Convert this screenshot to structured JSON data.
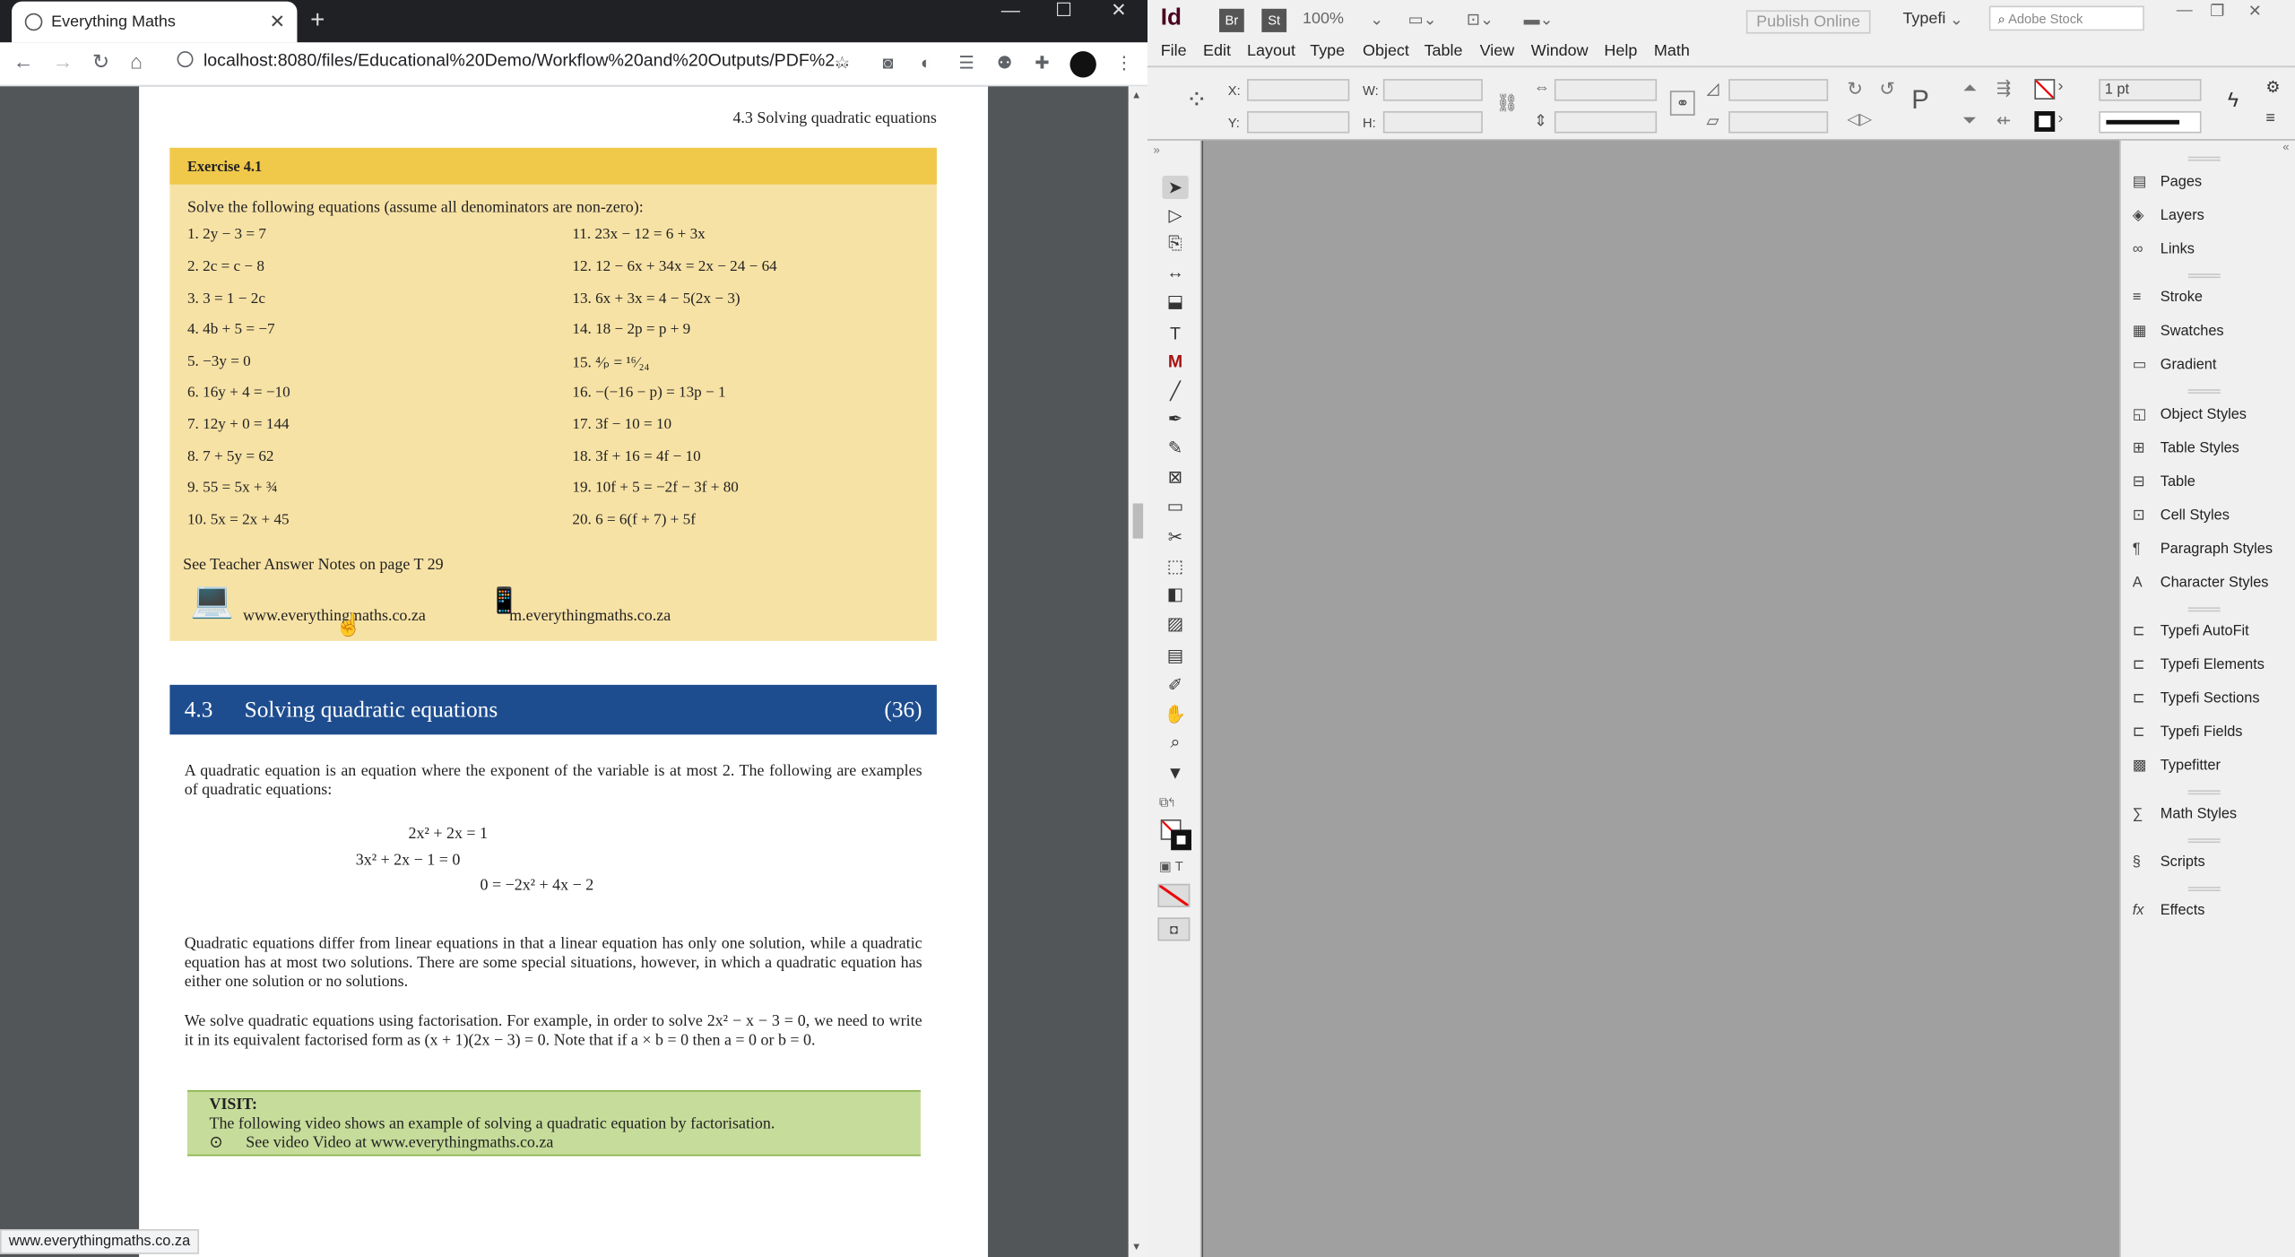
{
  "browser": {
    "tab_title": "Everything Maths",
    "new_tab": "+",
    "url": "localhost:8080/files/Educational%20Demo/Workflow%20and%20Outputs/PDF%2...",
    "status_url": "www.everythingmaths.co.za"
  },
  "document": {
    "running_head": "4.3 Solving quadratic equations",
    "exercise": {
      "title": "Exercise 4.1",
      "instruction": "Solve the following equations (assume all denominators are non-zero):",
      "left": [
        "1. 2y − 3 = 7",
        "2. 2c = c − 8",
        "3. 3 = 1 − 2c",
        "4. 4b + 5 = −7",
        "5. −3y = 0",
        "6. 16y + 4 = −10",
        "7. 12y + 0 = 144",
        "8. 7 + 5y = 62",
        "9. 55 = 5x + ¾",
        "10. 5x = 2x + 45"
      ],
      "right": [
        "11. 23x − 12 = 6 + 3x",
        "12. 12 − 6x + 34x = 2x − 24 − 64",
        "13. 6x + 3x = 4 − 5(2x − 3)",
        "14. 18 − 2p = p + 9",
        "15. ⁴⁄ₚ = ¹⁶⁄₂₄",
        "16. −(−16 − p) = 13p − 1",
        "17. 3f − 10 = 10",
        "18. 3f + 16 = 4f − 10",
        "19. 10f + 5 = −2f − 3f + 80",
        "20. 6 = 6(f + 7) + 5f"
      ],
      "note": "See Teacher Answer Notes on page T 29",
      "link_web": "www.everythingmaths.co.za",
      "link_mobile": "m.everythingmaths.co.za"
    },
    "section": {
      "number": "4.3",
      "title": "Solving quadratic equations",
      "count": "(36)"
    },
    "para1": "A quadratic equation is an equation where the exponent of the variable is at most 2. The following are examples of quadratic equations:",
    "examples": [
      "2x² + 2x = 1",
      "3x² + 2x − 1 = 0",
      "0 = −2x² + 4x − 2"
    ],
    "para2": "Quadratic equations differ from linear equations in that a linear equation has only one solution, while a quadratic equation has at most two solutions. There are some special situations, however, in which a quadratic equation has either one solution or no solutions.",
    "para3": "We solve quadratic equations using factorisation. For example, in order to solve 2x² − x − 3 = 0, we need to write it in its equivalent factorised form as (x + 1)(2x − 3) = 0. Note that if a × b = 0 then a = 0 or b = 0.",
    "visit": {
      "label": "VISIT:",
      "text": "The following video shows an example of solving a quadratic equation by factorisation.",
      "bullet": "See video Video at www.everythingmaths.co.za"
    }
  },
  "indesign": {
    "app_icon": "Id",
    "bridge": "Br",
    "stock": "St",
    "zoom": "100%",
    "publish": "Publish Online",
    "typefi_menu": "Typefi",
    "search_placeholder": "Adobe Stock",
    "menu": [
      "File",
      "Edit",
      "Layout",
      "Type",
      "Object",
      "Table",
      "View",
      "Window",
      "Help",
      "Math"
    ],
    "controls": {
      "x": "X:",
      "y": "Y:",
      "w": "W:",
      "h": "H:",
      "stroke_weight": "1 pt"
    },
    "panels": [
      {
        "label": "Pages",
        "icon": "pages-icon",
        "glyph": "▤"
      },
      {
        "label": "Layers",
        "icon": "layers-icon",
        "glyph": "◈"
      },
      {
        "label": "Links",
        "icon": "links-icon",
        "glyph": "∞"
      },
      {
        "label": "Stroke",
        "icon": "stroke-icon",
        "glyph": "≡"
      },
      {
        "label": "Swatches",
        "icon": "swatches-icon",
        "glyph": "▦"
      },
      {
        "label": "Gradient",
        "icon": "gradient-icon",
        "glyph": "▭"
      },
      {
        "label": "Object Styles",
        "icon": "object-styles-icon",
        "glyph": "◱"
      },
      {
        "label": "Table Styles",
        "icon": "table-styles-icon",
        "glyph": "⊞"
      },
      {
        "label": "Table",
        "icon": "table-icon",
        "glyph": "⊟"
      },
      {
        "label": "Cell Styles",
        "icon": "cell-styles-icon",
        "glyph": "⊡"
      },
      {
        "label": "Paragraph Styles",
        "icon": "paragraph-styles-icon",
        "glyph": "¶"
      },
      {
        "label": "Character Styles",
        "icon": "character-styles-icon",
        "glyph": "A"
      },
      {
        "label": "Typefi AutoFit",
        "icon": "typefi-autofit-icon",
        "glyph": "⊏"
      },
      {
        "label": "Typefi Elements",
        "icon": "typefi-elements-icon",
        "glyph": "⊏"
      },
      {
        "label": "Typefi Sections",
        "icon": "typefi-sections-icon",
        "glyph": "⊏"
      },
      {
        "label": "Typefi Fields",
        "icon": "typefi-fields-icon",
        "glyph": "⊏"
      },
      {
        "label": "Typefitter",
        "icon": "typefitter-icon",
        "glyph": "▩"
      },
      {
        "label": "Math Styles",
        "icon": "math-styles-icon",
        "glyph": "∑"
      },
      {
        "label": "Scripts",
        "icon": "scripts-icon",
        "glyph": "§"
      },
      {
        "label": "Effects",
        "icon": "effects-icon",
        "glyph": "fx"
      }
    ],
    "tools": [
      {
        "name": "selection-tool-icon",
        "glyph": "➤"
      },
      {
        "name": "direct-selection-tool-icon",
        "glyph": "▷"
      },
      {
        "name": "page-tool-icon",
        "glyph": "⎘"
      },
      {
        "name": "gap-tool-icon",
        "glyph": "↔"
      },
      {
        "name": "content-collector-icon",
        "glyph": "⬓"
      },
      {
        "name": "type-tool-icon",
        "glyph": "T"
      },
      {
        "name": "math-tool-icon",
        "glyph": "M"
      },
      {
        "name": "line-tool-icon",
        "glyph": "╱"
      },
      {
        "name": "pen-tool-icon",
        "glyph": "✒"
      },
      {
        "name": "pencil-tool-icon",
        "glyph": "✎"
      },
      {
        "name": "rectangle-frame-tool-icon",
        "glyph": "⊠"
      },
      {
        "name": "rectangle-tool-icon",
        "glyph": "▭"
      },
      {
        "name": "scissors-tool-icon",
        "glyph": "✂"
      },
      {
        "name": "free-transform-tool-icon",
        "glyph": "⬚"
      },
      {
        "name": "gradient-swatch-tool-icon",
        "glyph": "◧"
      },
      {
        "name": "gradient-feather-tool-icon",
        "glyph": "▨"
      },
      {
        "name": "note-tool-icon",
        "glyph": "▤"
      },
      {
        "name": "eyedropper-tool-icon",
        "glyph": "✐"
      },
      {
        "name": "hand-tool-icon",
        "glyph": "✋"
      },
      {
        "name": "zoom-tool-icon",
        "glyph": "⌕"
      },
      {
        "name": "more-tools-icon",
        "glyph": "▼"
      }
    ]
  }
}
